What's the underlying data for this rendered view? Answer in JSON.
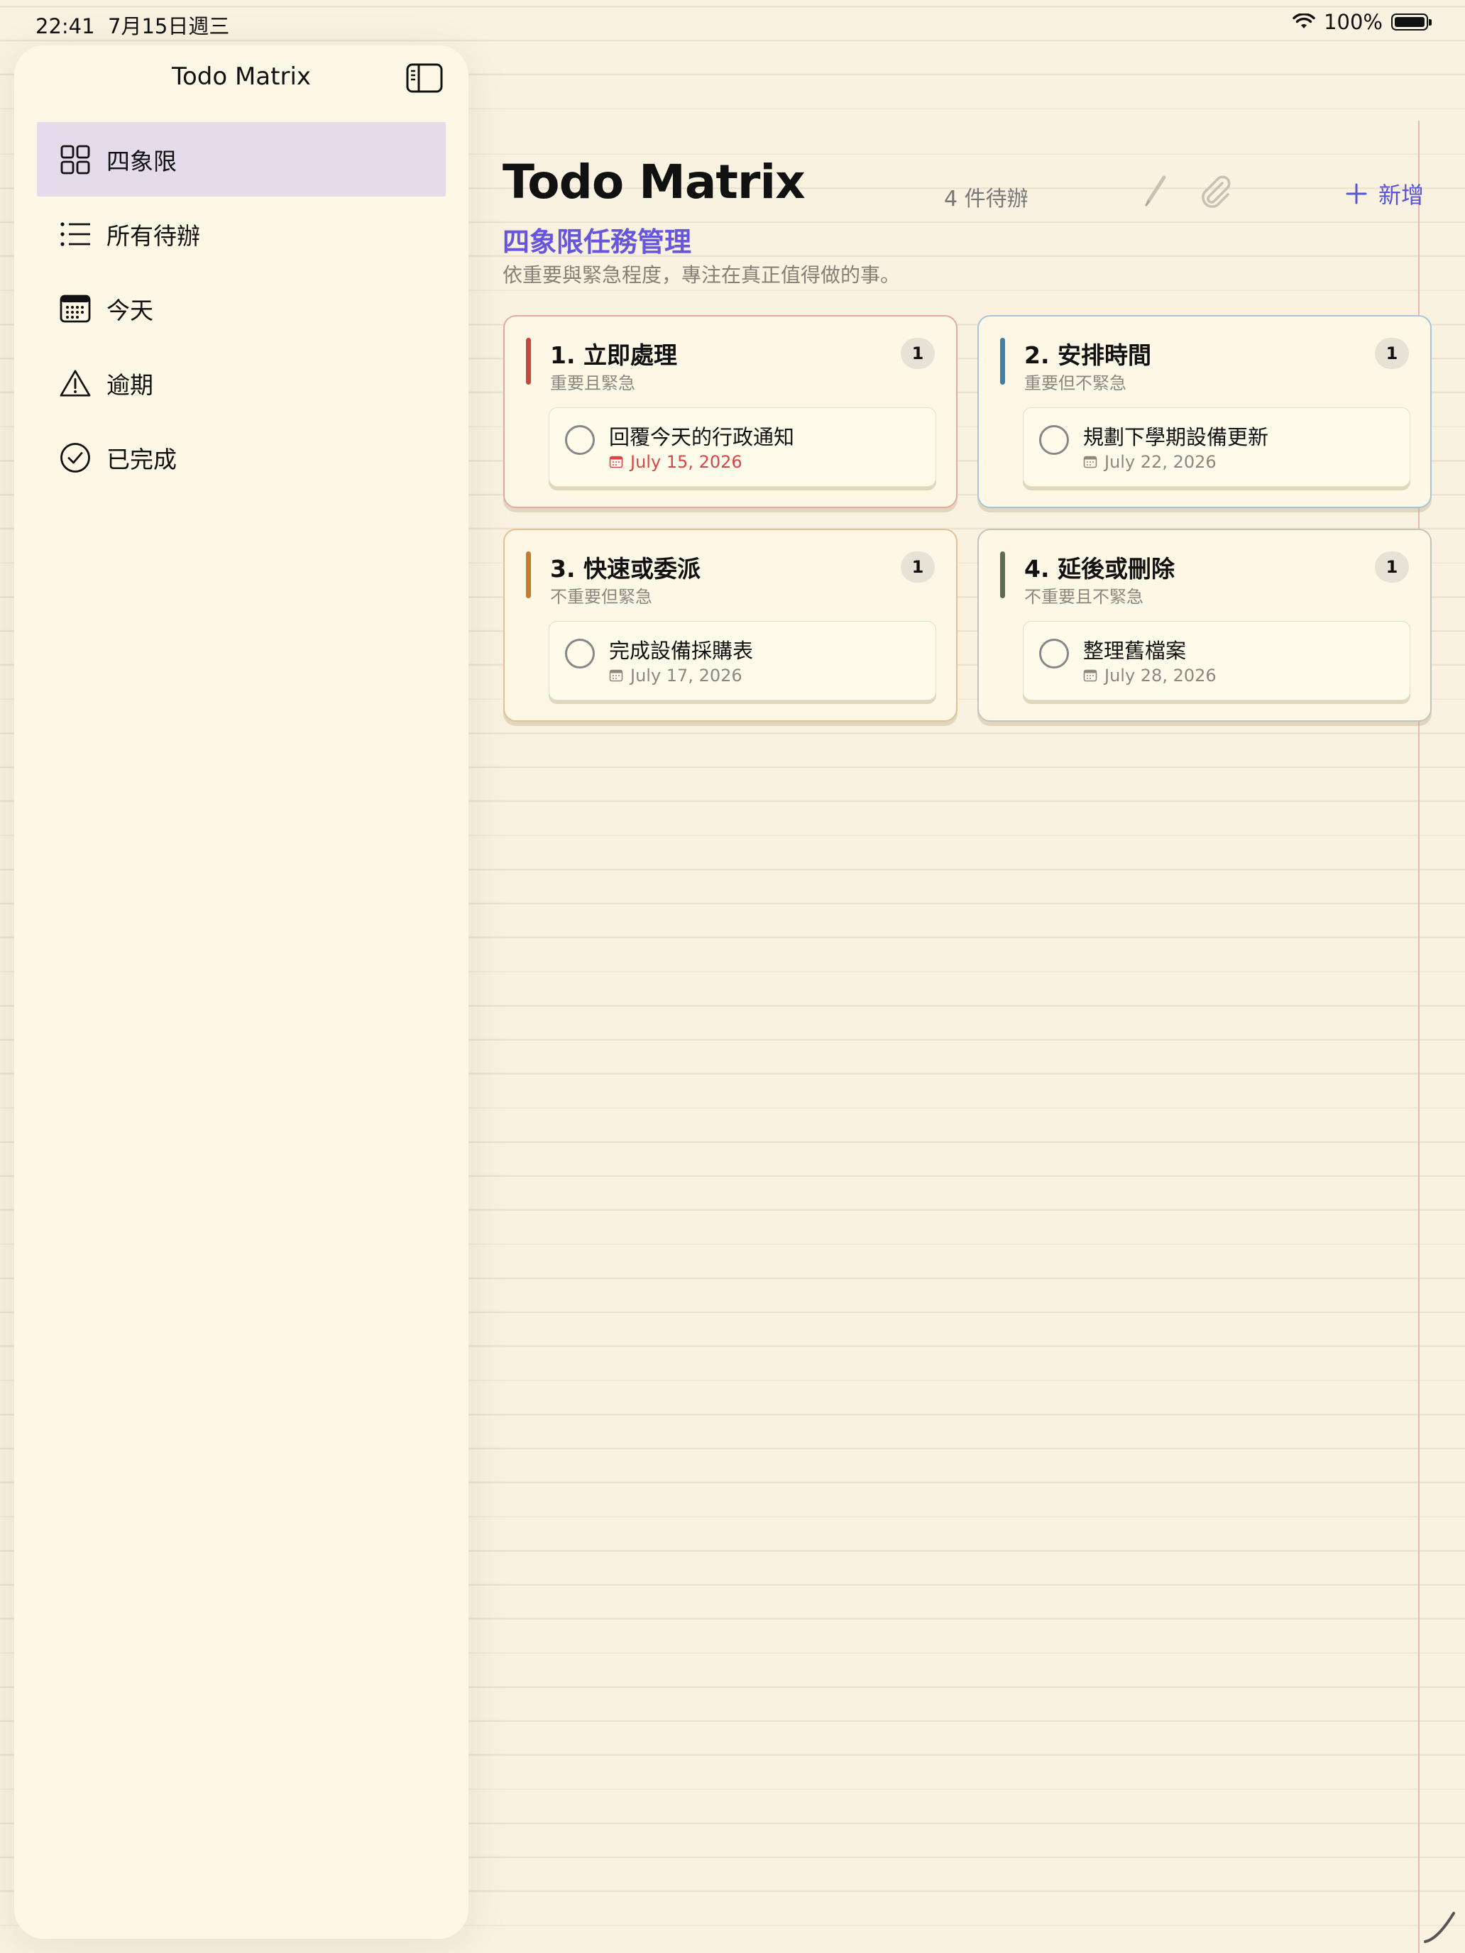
{
  "status_bar": {
    "time": "22:41",
    "date": "7月15日週三",
    "battery": "100%"
  },
  "sidebar": {
    "title": "Todo Matrix",
    "items": [
      {
        "label": "四象限",
        "icon": "grid-icon",
        "active": true
      },
      {
        "label": "所有待辦",
        "icon": "list-icon",
        "active": false
      },
      {
        "label": "今天",
        "icon": "calendar-icon",
        "active": false
      },
      {
        "label": "逾期",
        "icon": "warning-icon",
        "active": false
      },
      {
        "label": "已完成",
        "icon": "checkmark-circle-icon",
        "active": false
      }
    ]
  },
  "header": {
    "title": "Todo Matrix",
    "pending_count": "4 件待辦",
    "add_label": "新增",
    "subtitle": "四象限任務管理",
    "description": "依重要與緊急程度，專注在真正值得做的事。"
  },
  "quadrants": [
    {
      "title": "1. 立即處理",
      "subtitle": "重要且緊急",
      "count": "1",
      "color": "#c9463d",
      "tasks": [
        {
          "title": "回覆今天的行政通知",
          "date": "July 15, 2026",
          "overdue": true
        }
      ]
    },
    {
      "title": "2. 安排時間",
      "subtitle": "重要但不緊急",
      "count": "1",
      "color": "#3d7fa8",
      "tasks": [
        {
          "title": "規劃下學期設備更新",
          "date": "July 22, 2026",
          "overdue": false
        }
      ]
    },
    {
      "title": "3. 快速或委派",
      "subtitle": "不重要但緊急",
      "count": "1",
      "color": "#c77a2e",
      "tasks": [
        {
          "title": "完成設備採購表",
          "date": "July 17, 2026",
          "overdue": false
        }
      ]
    },
    {
      "title": "4. 延後或刪除",
      "subtitle": "不重要且不緊急",
      "count": "1",
      "color": "#5e6b55",
      "tasks": [
        {
          "title": "整理舊檔案",
          "date": "July 28, 2026",
          "overdue": false
        }
      ]
    }
  ],
  "colors": {
    "accent": "#5757d6",
    "subtitle": "#6656de",
    "active_nav": "#e4dcea",
    "paper": "#f9f2e1",
    "overdue": "#d84646"
  }
}
